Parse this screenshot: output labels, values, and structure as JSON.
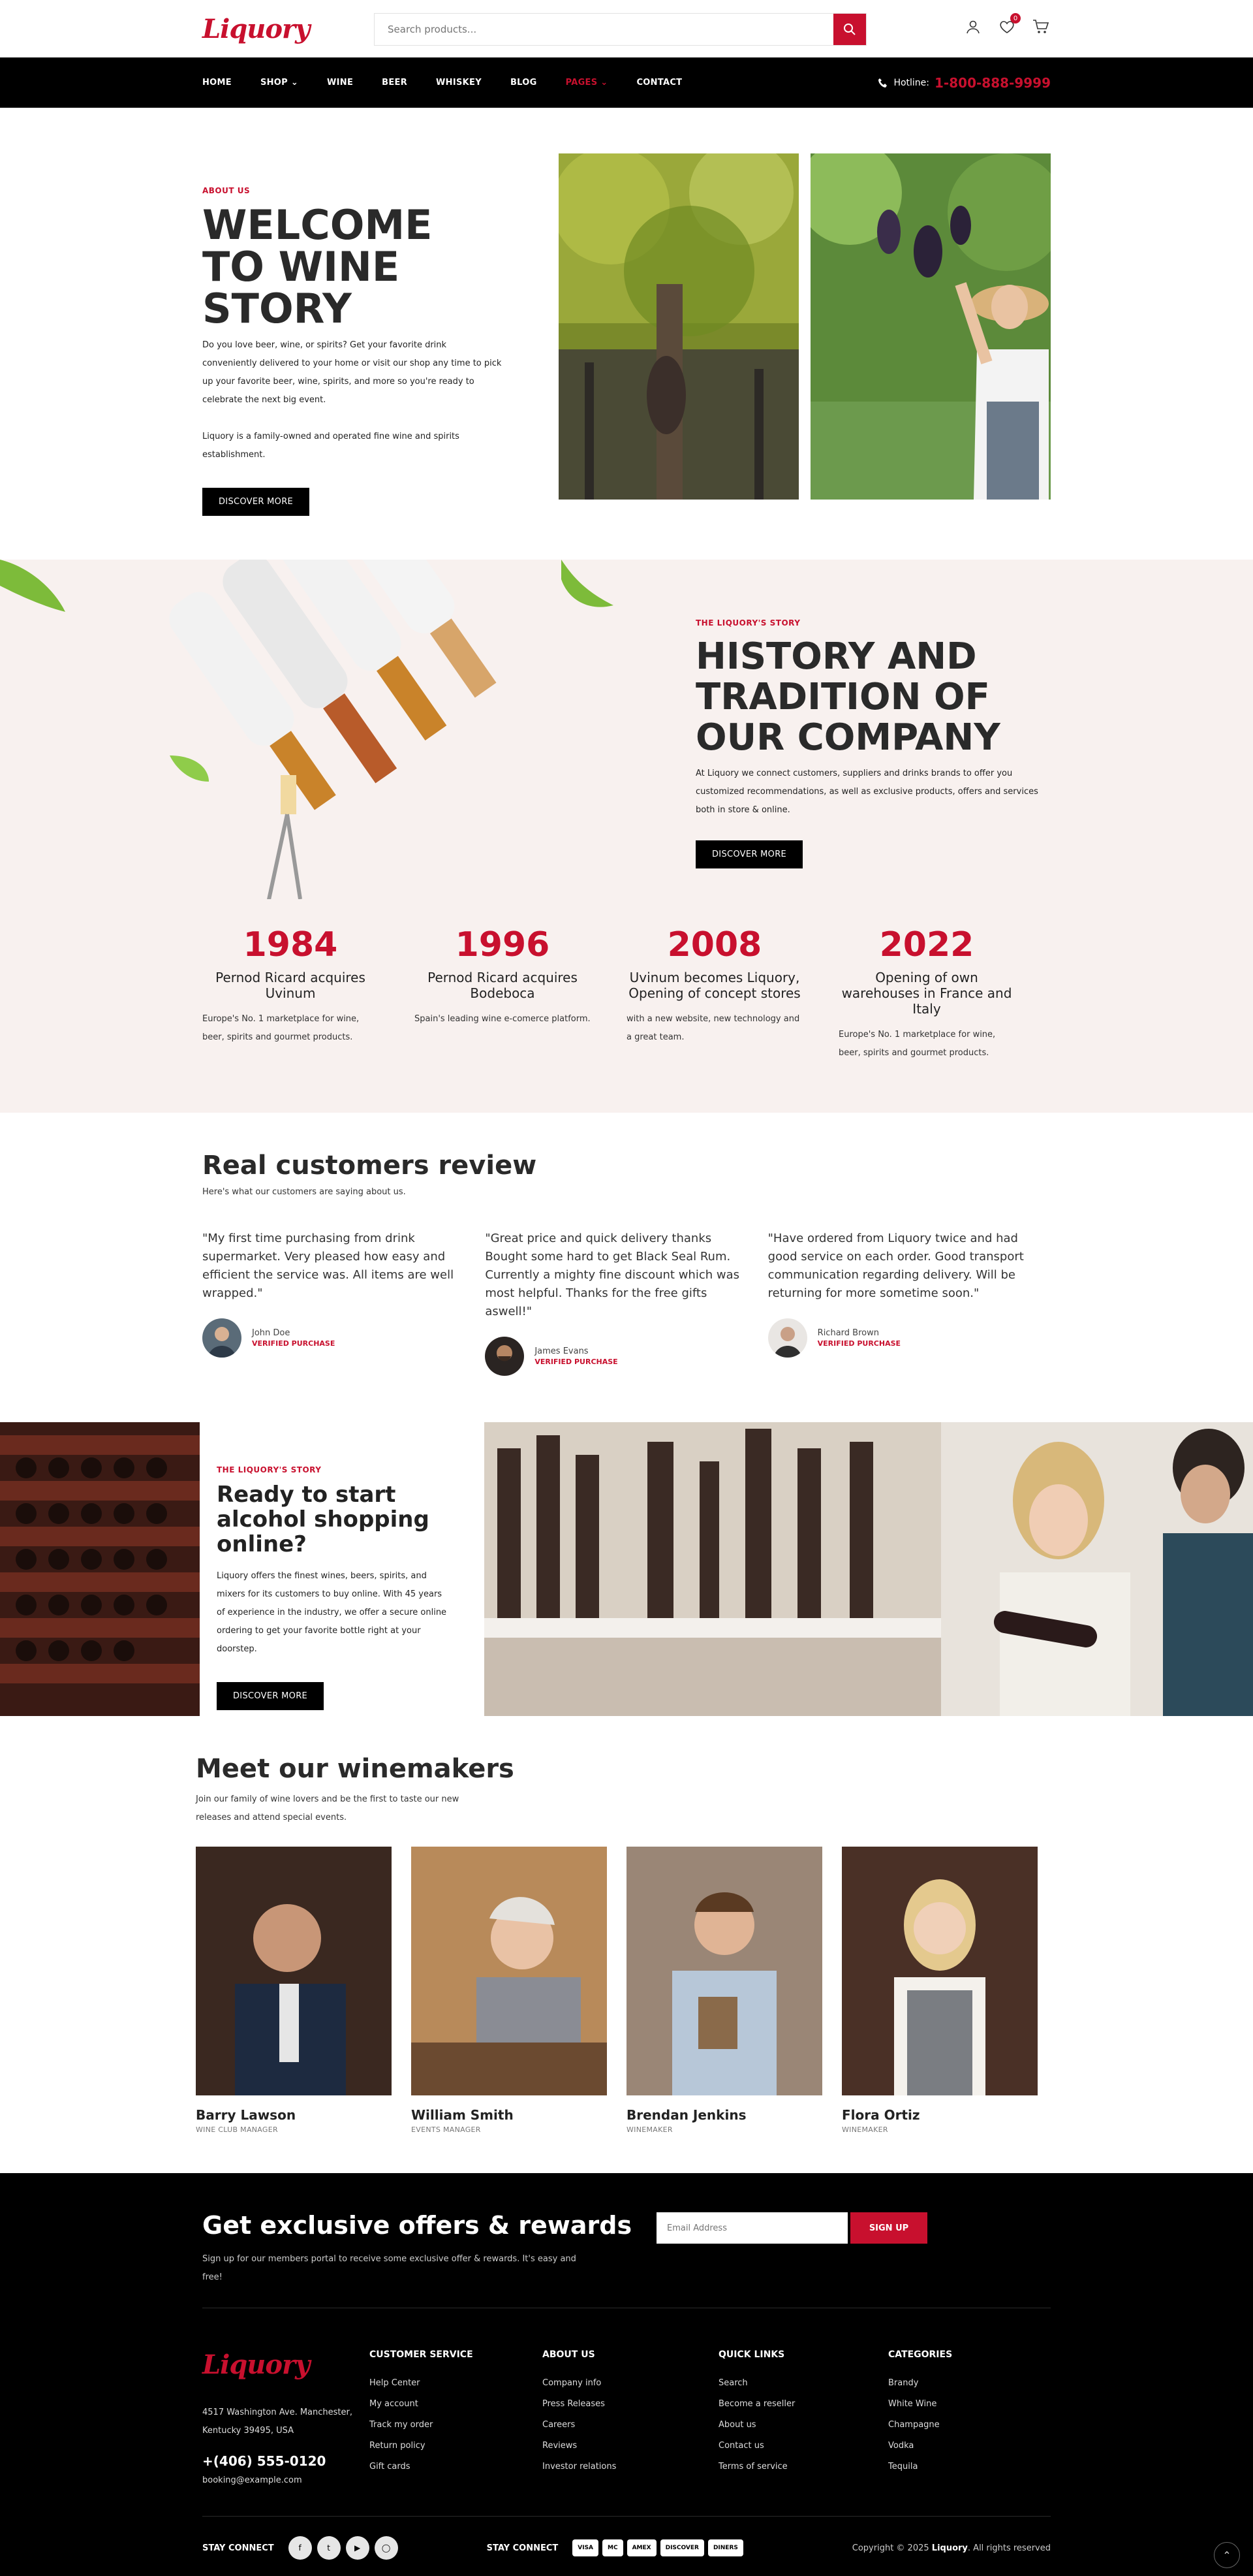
{
  "header": {
    "logo": "Liquory",
    "search_placeholder": "Search products...",
    "cart_count": "0",
    "brand_color": "#c8102e"
  },
  "nav": {
    "items": [
      "HOME",
      "SHOP",
      "WINE",
      "BEER",
      "WHISKEY",
      "BLOG",
      "PAGES",
      "CONTACT"
    ],
    "hotline_label": "Hotline:",
    "hotline_number": "1-800-888-9999"
  },
  "hero": {
    "eyebrow": "ABOUT US",
    "title": "WELCOME TO WINE STORY",
    "para1": "Do you love beer, wine, or spirits? Get your favorite drink conveniently delivered to your home or visit our shop any time to pick up your favorite beer, wine, spirits, and more so you're ready to celebrate the next big event.",
    "para2": "Liquory is a family-owned and operated fine wine and spirits establishment.",
    "button": "DISCOVER MORE"
  },
  "history": {
    "eyebrow": "THE LIQUORY'S STORY",
    "title": "HISTORY AND TRADITION OF OUR COMPANY",
    "para": "At Liquory we connect customers, suppliers and drinks brands to offer you customized recommendations, as well as exclusive products, offers and services both in store & online.",
    "button": "DISCOVER MORE",
    "timeline": [
      {
        "year": "1984",
        "title": "Pernod Ricard acquires Uvinum",
        "desc": "Europe's No. 1 marketplace for wine, beer, spirits and gourmet products."
      },
      {
        "year": "1996",
        "title": "Pernod Ricard acquires Bodeboca",
        "desc": "Spain's leading wine e-comerce platform."
      },
      {
        "year": "2008",
        "title": "Uvinum becomes Liquory, Opening of concept stores",
        "desc": "with a new website, new technology and a great team."
      },
      {
        "year": "2022",
        "title": "Opening of own warehouses in France and Italy",
        "desc": "Europe's No. 1 marketplace for wine, beer, spirits and gourmet products."
      }
    ]
  },
  "reviews": {
    "title": "Real customers review",
    "subtitle": "Here's what our customers are saying about us.",
    "items": [
      {
        "quote": "\"My first time purchasing from drink supermarket. Very pleased how easy and efficient the service was. All items are well wrapped.\"",
        "name": "John Doe",
        "badge": "VERIFIED PURCHASE"
      },
      {
        "quote": "\"Great price and quick delivery thanks Bought some hard to get Black Seal Rum. Currently a mighty fine discount which was most helpful. Thanks for the free gifts aswell!\"",
        "name": "James Evans",
        "badge": "VERIFIED PURCHASE"
      },
      {
        "quote": "\"Have ordered from Liquory twice and had good service on each order. Good transport communication regarding delivery. Will be returning for more sometime soon.\"",
        "name": "Richard Brown",
        "badge": "VERIFIED PURCHASE"
      }
    ]
  },
  "promo": {
    "eyebrow": "THE LIQUORY'S STORY",
    "title": "Ready to start alcohol shopping online?",
    "para": "Liquory offers the finest wines, beers, spirits, and mixers for its customers to buy online. With 45 years of experience in the industry, we offer a secure online ordering to get your favorite bottle right at your doorstep.",
    "button": "DISCOVER MORE"
  },
  "team": {
    "title": "Meet our winemakers",
    "subtitle": "Join our family of wine lovers and be the first to taste our new releases and attend special events.",
    "members": [
      {
        "name": "Barry Lawson",
        "role": "WINE CLUB MANAGER"
      },
      {
        "name": "William Smith",
        "role": "EVENTS MANAGER"
      },
      {
        "name": "Brendan Jenkins",
        "role": "WINEMAKER"
      },
      {
        "name": "Flora Ortiz",
        "role": "WINEMAKER"
      }
    ]
  },
  "newsletter": {
    "title": "Get exclusive offers & rewards",
    "subtitle": "Sign up for our members portal to receive some exclusive offer & rewards. It's easy and free!",
    "placeholder": "Email Address",
    "button": "SIGN UP"
  },
  "footer": {
    "logo": "Liquory",
    "address": "4517 Washington Ave. Manchester, Kentucky 39495, USA",
    "phone": "+(406) 555-0120",
    "email": "booking@example.com",
    "columns": [
      {
        "title": "CUSTOMER SERVICE",
        "links": [
          "Help Center",
          "My account",
          "Track my order",
          "Return policy",
          "Gift cards"
        ]
      },
      {
        "title": "ABOUT US",
        "links": [
          "Company info",
          "Press Releases",
          "Careers",
          "Reviews",
          "Investor relations"
        ]
      },
      {
        "title": "QUICK LINKS",
        "links": [
          "Search",
          "Become a reseller",
          "About us",
          "Contact us",
          "Terms of service"
        ]
      },
      {
        "title": "CATEGORIES",
        "links": [
          "Brandy",
          "White Wine",
          "Champagne",
          "Vodka",
          "Tequila"
        ]
      }
    ],
    "stay_connect_1": "STAY CONNECT",
    "stay_connect_2": "STAY CONNECT",
    "payments": [
      "VISA",
      "MC",
      "AMEX",
      "DISCOVER",
      "DINERS"
    ],
    "copyright_pre": "Copyright © 2025",
    "copyright_brand": "Liquory",
    "copyright_post": ". All rights reserved"
  }
}
